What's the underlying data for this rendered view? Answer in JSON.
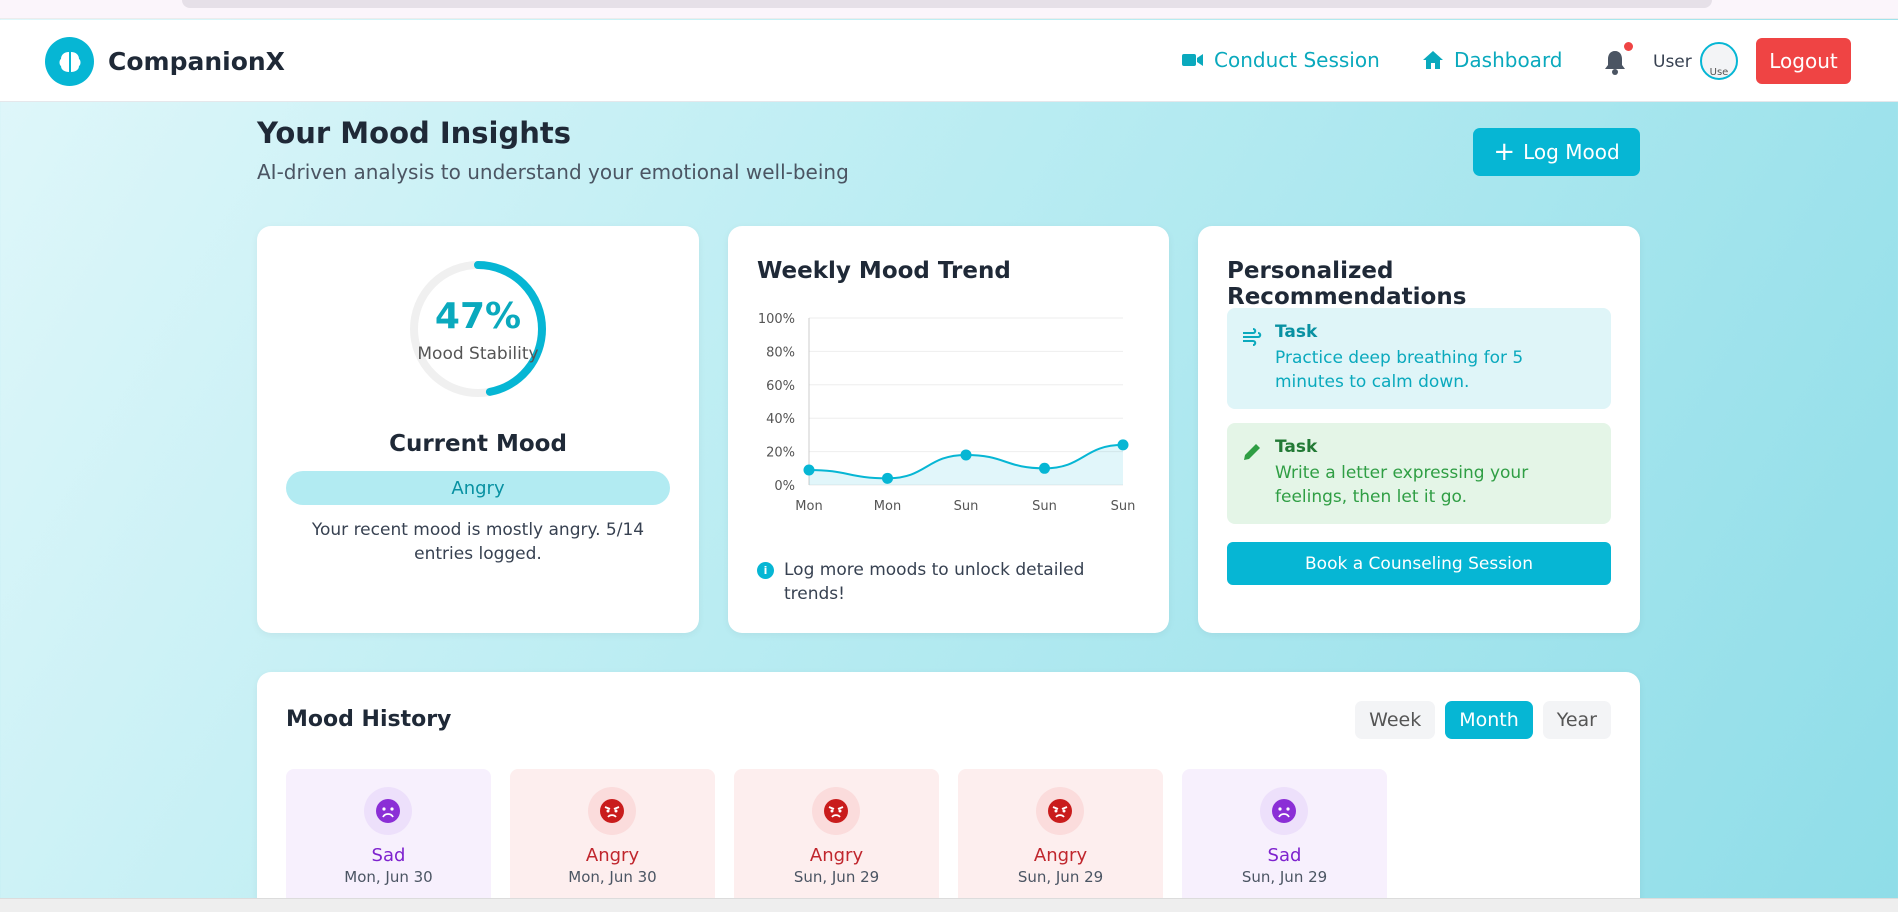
{
  "navbar": {
    "brand": "CompanionX",
    "conduct_session": "Conduct Session",
    "dashboard": "Dashboard",
    "user_label": "User",
    "avatar_alt": "Use",
    "logout": "Logout"
  },
  "header": {
    "title": "Your Mood Insights",
    "subtitle": "AI-driven analysis to understand your emotional well-being",
    "log_mood": "Log Mood"
  },
  "stability": {
    "percent_text": "47%",
    "percent": 47,
    "label": "Mood Stability",
    "current_title": "Current Mood",
    "current_mood": "Angry",
    "description": "Your recent mood is mostly angry. 5/14 entries logged."
  },
  "trend": {
    "title": "Weekly Mood Trend",
    "note": "Log more moods to unlock detailed trends!"
  },
  "chart_data": {
    "type": "area",
    "title": "Weekly Mood Trend",
    "categories": [
      "Mon",
      "Mon",
      "Sun",
      "Sun",
      "Sun"
    ],
    "values": [
      9,
      4,
      18,
      10,
      24
    ],
    "y_ticks": [
      "0%",
      "20%",
      "40%",
      "60%",
      "80%",
      "100%"
    ],
    "ylim": [
      0,
      100
    ],
    "grid": true,
    "line_color": "#06b6d4"
  },
  "recommendations": {
    "title": "Personalized Recommendations",
    "items": [
      {
        "heading": "Task",
        "text": "Practice deep breathing for 5 minutes to calm down.",
        "icon": "wind-icon"
      },
      {
        "heading": "Task",
        "text": "Write a letter expressing your feelings, then let it go.",
        "icon": "pencil-icon"
      }
    ],
    "book_button": "Book a Counseling Session"
  },
  "history": {
    "title": "Mood History",
    "tabs": [
      "Week",
      "Month",
      "Year"
    ],
    "active_tab": "Month",
    "entries": [
      {
        "mood": "Sad",
        "date": "Mon, Jun 30"
      },
      {
        "mood": "Angry",
        "date": "Mon, Jun 30"
      },
      {
        "mood": "Angry",
        "date": "Sun, Jun 29"
      },
      {
        "mood": "Angry",
        "date": "Sun, Jun 29"
      },
      {
        "mood": "Sad",
        "date": "Sun, Jun 29"
      }
    ]
  },
  "colors": {
    "accent": "#06b6d4",
    "logout": "#ef4444",
    "sad": "#7e22ce",
    "angry": "#c0262d"
  }
}
